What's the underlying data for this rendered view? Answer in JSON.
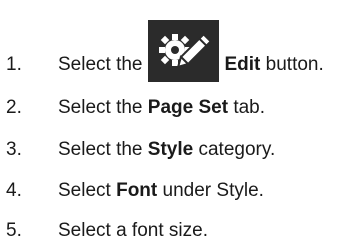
{
  "steps": [
    {
      "number": "1.",
      "before": "Select the ",
      "bold": "Edit",
      "after": " button.",
      "icon": "edit-settings-icon"
    },
    {
      "number": "2.",
      "before": "Select the ",
      "bold": "Page Set",
      "after": " tab."
    },
    {
      "number": "3.",
      "before": "Select the ",
      "bold": "Style",
      "after": " category."
    },
    {
      "number": "4.",
      "before": "Select ",
      "bold": "Font",
      "after": " under Style."
    },
    {
      "number": "5.",
      "before": "Select a font size.",
      "bold": "",
      "after": ""
    }
  ],
  "colors": {
    "icon_bg": "#2b2b2b",
    "icon_fg": "#ffffff",
    "text": "#1a1a1a"
  }
}
